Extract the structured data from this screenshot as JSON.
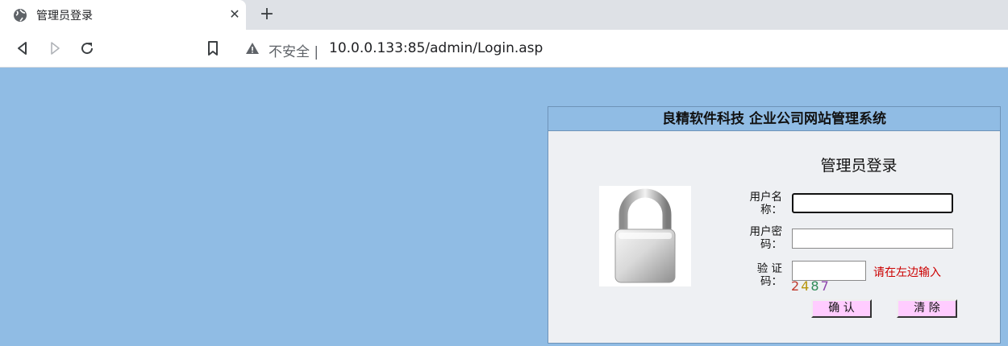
{
  "browser": {
    "tab": {
      "title": "管理员登录",
      "close_glyph": "✕",
      "favicon": "globe-icon"
    },
    "new_tab_glyph": "+",
    "toolbar": {
      "back": "back-icon",
      "forward": "forward-icon",
      "reload": "reload-icon",
      "bookmark": "bookmark-icon"
    },
    "omnibox": {
      "security_text": "不安全",
      "url": "10.0.0.133:85/admin/Login.asp",
      "warning_icon": "warning-icon"
    }
  },
  "page": {
    "header": "良精软件科技 企业公司网站管理系统",
    "login_title": "管理员登录",
    "fields": {
      "username": {
        "label_line1": "用户名",
        "label_line2": "称：",
        "value": ""
      },
      "password": {
        "label_line1": "用户密",
        "label_line2": "码：",
        "value": ""
      },
      "captcha": {
        "label_line1": "验 证",
        "label_line2": "码：",
        "value": "",
        "hint": "请在左边输入"
      }
    },
    "captcha_digits": [
      "2",
      "4",
      "8",
      "7"
    ],
    "buttons": {
      "confirm": "确 认",
      "clear": "清 除"
    },
    "lock_icon": "padlock-icon"
  },
  "colors": {
    "page_bg": "#90bce4",
    "panel_bg": "#eef0f3",
    "button_bg": "#ffccff",
    "hint": "#cc0000"
  }
}
